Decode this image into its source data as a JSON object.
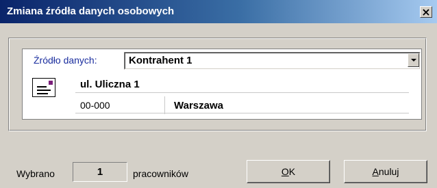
{
  "window": {
    "title": "Zmiana źródła danych osobowych",
    "close_glyph": "×"
  },
  "source": {
    "label": "Źródło danych:",
    "selected": "Kontrahent 1"
  },
  "address": {
    "street": "ul. Uliczna 1",
    "postal_code": "00-000",
    "city": "Warszawa"
  },
  "footer": {
    "selected_prefix": "Wybrano",
    "selected_count": "1",
    "selected_suffix": "pracowników",
    "ok": {
      "mnemonic": "O",
      "rest": "K"
    },
    "cancel": {
      "mnemonic": "A",
      "rest": "nuluj"
    }
  }
}
